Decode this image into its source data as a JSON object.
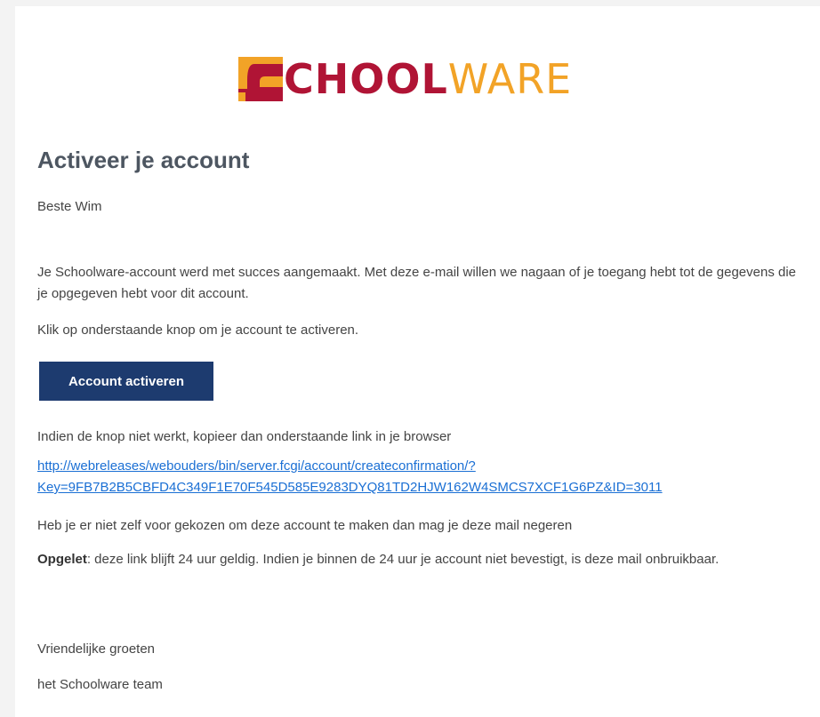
{
  "logo": {
    "mark_color_top": "#f2a327",
    "mark_color_bottom": "#b01435",
    "text_bold": "CHOOL",
    "text_light": "WARE",
    "brand_red": "#b01435",
    "brand_orange": "#f2a327"
  },
  "email": {
    "title": "Activeer je account",
    "greeting": "Beste Wim",
    "paragraph1": "Je Schoolware-account werd met succes aangemaakt. Met deze e-mail willen we nagaan of je toegang hebt tot de gegevens die je opgegeven hebt voor dit account.",
    "paragraph2": "Klik op onderstaande knop om je account te activeren.",
    "button_label": "Account activeren",
    "button_color": "#1d3b6f",
    "fallback_text": "Indien de knop niet werkt, kopieer dan onderstaande link in je browser",
    "link_line1": "http://webreleases/webouders/bin/server.fcgi/account/createconfirmation/?",
    "link_line2": "Key=9FB7B2B5CBFD4C349F1E70F545D585E9283DYQ81TD2HJW162W4SMCS7XCF1G6PZ&ID=3011",
    "ignore_text": "Heb je er niet zelf voor gekozen om deze account te maken dan mag je deze mail negeren",
    "warning_label": "Opgelet",
    "warning_text": ": deze link blijft 24 uur geldig. Indien je binnen de 24 uur je account niet bevestigt, is deze mail onbruikbaar.",
    "closing": "Vriendelijke groeten",
    "signature": "het Schoolware team"
  }
}
